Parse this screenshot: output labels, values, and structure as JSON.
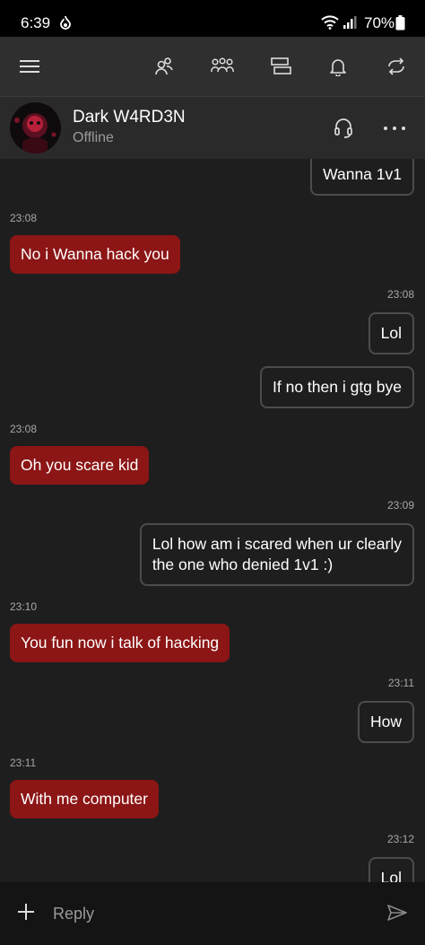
{
  "status_bar": {
    "time": "6:39",
    "battery": "70%"
  },
  "nav": {
    "icons": [
      "menu-icon",
      "friends-icon",
      "party-icon",
      "messages-icon",
      "notifications-icon",
      "sync-icon"
    ]
  },
  "chat_header": {
    "name": "Dark W4RD3N",
    "status": "Offline"
  },
  "messages": [
    {
      "dir": "out",
      "text": "Wanna 1v1"
    },
    {
      "dir": "ts-in",
      "text": "23:08"
    },
    {
      "dir": "in",
      "text": "No i Wanna hack you"
    },
    {
      "dir": "ts-out",
      "text": "23:08"
    },
    {
      "dir": "out",
      "text": "Lol"
    },
    {
      "dir": "out",
      "text": "If no then i gtg bye"
    },
    {
      "dir": "ts-in",
      "text": "23:08"
    },
    {
      "dir": "in",
      "text": "Oh you scare kid"
    },
    {
      "dir": "ts-out",
      "text": "23:09"
    },
    {
      "dir": "out",
      "lines": [
        "Lol how am i scared when ur clearly",
        "the one who denied 1v1 :)"
      ]
    },
    {
      "dir": "ts-in",
      "text": "23:10"
    },
    {
      "dir": "in",
      "text": "You fun now i talk of hacking"
    },
    {
      "dir": "ts-out",
      "text": "23:11"
    },
    {
      "dir": "out",
      "text": "How"
    },
    {
      "dir": "ts-in",
      "text": "23:11"
    },
    {
      "dir": "in",
      "text": "With me computer"
    },
    {
      "dir": "ts-out",
      "text": "23:12"
    },
    {
      "dir": "out",
      "text": "Lol"
    }
  ],
  "composer": {
    "placeholder": "Reply"
  },
  "colors": {
    "incoming_bubble": "#8c1515",
    "outgoing_border": "#4c4c4c",
    "background": "#1e1e1e"
  }
}
